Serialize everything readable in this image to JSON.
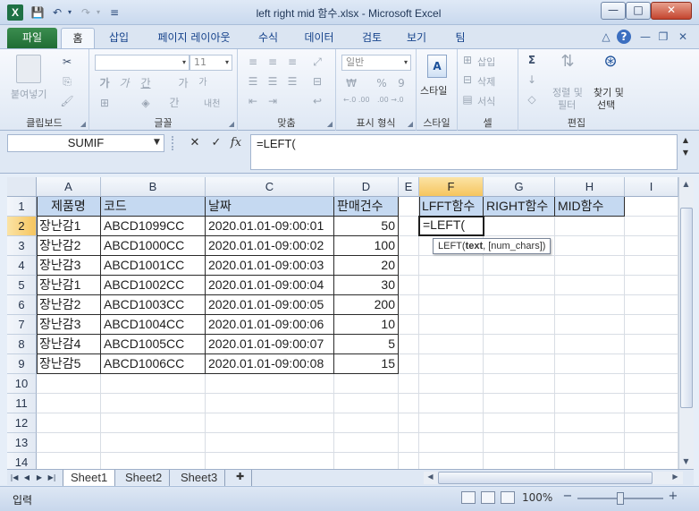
{
  "window": {
    "title": "left right mid 함수.xlsx  -  Microsoft Excel",
    "app_icon": "X",
    "qat": {
      "save": "💾",
      "undo": "↶",
      "undo_arrow": "▾",
      "redo": "↷",
      "redo_arrow": "▾",
      "customize": "≡"
    },
    "controls": {
      "minimize": "—",
      "maximize": "□",
      "close": "✕"
    }
  },
  "ribbon_tabs": [
    "파일",
    "홈",
    "삽입",
    "페이지 레이아웃",
    "수식",
    "데이터",
    "검토",
    "보기",
    "팀"
  ],
  "ribbon_right": {
    "collapse": "△",
    "help": "?",
    "min": "—",
    "restore": "❐",
    "close": "✕"
  },
  "ribbon": {
    "clipboard": {
      "label": "클립보드",
      "paste": "붙여넣기",
      "cut_icon": "✂",
      "copy_icon": "⎘",
      "brush_icon": "🖌"
    },
    "font": {
      "label": "글꼴",
      "size": "11",
      "bold": "가",
      "italic": "가",
      "underline": "간",
      "grow": "가",
      "shrink": "가",
      "border": "⊞",
      "fill": "◈",
      "fontcolor": "간",
      "phonetic": "내천"
    },
    "alignment": {
      "label": "맞춤"
    },
    "number": {
      "label": "표시 형식",
      "format": "일반",
      "currency": "₩",
      "percent": "%",
      "comma": "9",
      "inc": "←.0 .00",
      "dec": ".00 →.0"
    },
    "styles": {
      "label": "스타일",
      "style_btn": "스타일"
    },
    "cells": {
      "label": "셀",
      "insert": "삽입",
      "delete": "삭제",
      "format": "서식"
    },
    "editing": {
      "label": "편집",
      "sum_icon": "Σ",
      "sort": "정렬 및",
      "sort2": "필터",
      "find": "찾기 및",
      "find2": "선택"
    }
  },
  "formula_bar": {
    "name_box": "SUMIF",
    "cancel": "✕",
    "enter": "✓",
    "fx": "fx",
    "formula": "=LEFT("
  },
  "columns": [
    "A",
    "B",
    "C",
    "D",
    "E",
    "F",
    "G",
    "H",
    "I"
  ],
  "rows": [
    "1",
    "2",
    "3",
    "4",
    "5",
    "6",
    "7",
    "8",
    "9",
    "10",
    "11",
    "12",
    "13",
    "14"
  ],
  "table": {
    "headers": [
      "제품명",
      "코드",
      "날짜",
      "판매건수"
    ],
    "rows": [
      [
        "장난감1",
        "ABCD1099CC",
        "2020.01.01-09:00:01",
        "50"
      ],
      [
        "장난감2",
        "ABCD1000CC",
        "2020.01.01-09:00:02",
        "100"
      ],
      [
        "장난감3",
        "ABCD1001CC",
        "2020.01.01-09:00:03",
        "20"
      ],
      [
        "장난감1",
        "ABCD1002CC",
        "2020.01.01-09:00:04",
        "30"
      ],
      [
        "장난감2",
        "ABCD1003CC",
        "2020.01.01-09:00:05",
        "200"
      ],
      [
        "장난감3",
        "ABCD1004CC",
        "2020.01.01-09:00:06",
        "10"
      ],
      [
        "장난감4",
        "ABCD1005CC",
        "2020.01.01-09:00:07",
        "5"
      ],
      [
        "장난감5",
        "ABCD1006CC",
        "2020.01.01-09:00:08",
        "15"
      ]
    ]
  },
  "func_headers": [
    "LFFT함수",
    "RIGHT함수",
    "MID함수"
  ],
  "active_cell": {
    "value": "=LEFT("
  },
  "tooltip": {
    "fn": "LEFT(",
    "arg1": "text",
    "rest": ", [num_chars])"
  },
  "sheets": [
    "Sheet1",
    "Sheet2",
    "Sheet3"
  ],
  "status": {
    "mode": "입력",
    "zoom": "100%"
  }
}
